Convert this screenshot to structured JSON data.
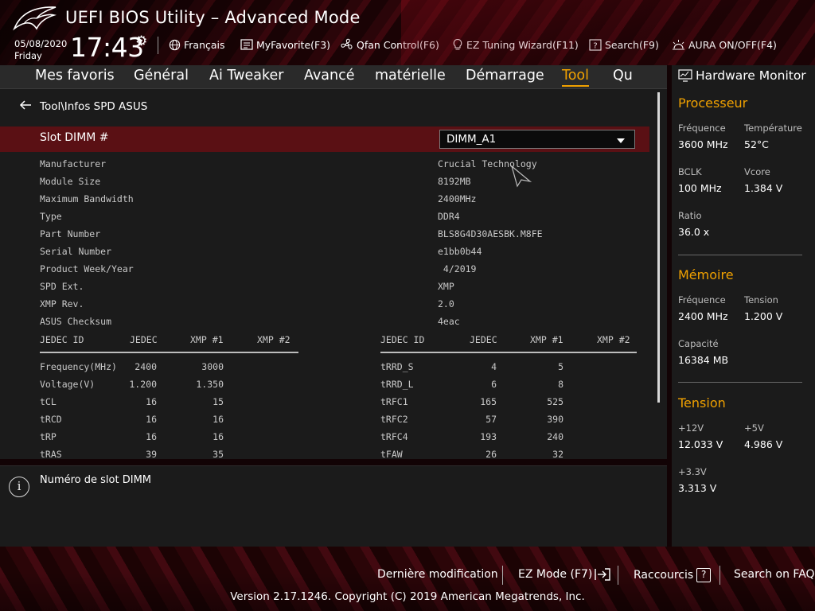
{
  "header": {
    "title": "UEFI BIOS Utility – Advanced Mode",
    "date": "05/08/2020",
    "day": "Friday",
    "time": "17:43",
    "buttons": [
      {
        "label": "Français",
        "icon": "globe-icon"
      },
      {
        "label": "MyFavorite(F3)",
        "icon": "favorite-icon"
      },
      {
        "label": "Qfan Control(F6)",
        "icon": "fan-icon"
      },
      {
        "label": "EZ Tuning Wizard(F11)",
        "icon": "bulb-icon"
      },
      {
        "label": "Search(F9)",
        "icon": "search-help-icon"
      },
      {
        "label": "AURA ON/OFF(F4)",
        "icon": "aura-icon"
      }
    ]
  },
  "tabs": [
    "Mes favoris",
    "Général",
    "Ai Tweaker",
    "Avancé",
    "matérielle",
    "Démarrage",
    "Tool",
    "Qu"
  ],
  "active_tab": "Tool",
  "breadcrumb": "Tool\\Infos SPD ASUS",
  "slot": {
    "label": "Slot DIMM #",
    "value": "DIMM_A1"
  },
  "spd_info": [
    {
      "key": "Manufacturer",
      "value": "Crucial Technology"
    },
    {
      "key": "Module Size",
      "value": "8192MB"
    },
    {
      "key": "Maximum Bandwidth",
      "value": "2400MHz"
    },
    {
      "key": "Type",
      "value": "DDR4"
    },
    {
      "key": "Part Number",
      "value": "BLS8G4D30AESBK.M8FE"
    },
    {
      "key": "Serial Number",
      "value": "e1bb0b44"
    },
    {
      "key": "Product Week/Year",
      "value": " 4/2019"
    },
    {
      "key": "SPD Ext.",
      "value": "XMP"
    },
    {
      "key": "XMP Rev.",
      "value": "2.0"
    },
    {
      "key": "ASUS Checksum",
      "value": "4eac"
    }
  ],
  "timing_table": {
    "headers": [
      "JEDEC ID",
      "JEDEC",
      "XMP #1",
      "XMP #2"
    ],
    "left_rows": [
      [
        "Frequency(MHz)",
        "2400",
        "3000",
        ""
      ],
      [
        "Voltage(V)",
        "1.200",
        "1.350",
        ""
      ],
      [
        "tCL",
        "16",
        "15",
        ""
      ],
      [
        "tRCD",
        "16",
        "16",
        ""
      ],
      [
        "tRP",
        "16",
        "16",
        ""
      ],
      [
        "tRAS",
        "39",
        "35",
        ""
      ]
    ],
    "right_rows": [
      [
        "tRRD_S",
        "4",
        "5",
        ""
      ],
      [
        "tRRD_L",
        "6",
        "8",
        ""
      ],
      [
        "tRFC1",
        "165",
        "525",
        ""
      ],
      [
        "tRFC2",
        "57",
        "390",
        ""
      ],
      [
        "tRFC4",
        "193",
        "240",
        ""
      ],
      [
        "tFAW",
        "26",
        "32",
        ""
      ]
    ]
  },
  "help_text": "Numéro de slot DIMM",
  "hardware_monitor": {
    "title": "Hardware Monitor",
    "sections": [
      {
        "title": "Processeur",
        "items": [
          {
            "label": "Fréquence",
            "value": "3600 MHz"
          },
          {
            "label": "Température",
            "value": "52°C"
          },
          {
            "label": "BCLK",
            "value": "100 MHz"
          },
          {
            "label": "Vcore",
            "value": "1.384 V"
          },
          {
            "label": "Ratio",
            "value": "36.0 x"
          }
        ]
      },
      {
        "title": "Mémoire",
        "items": [
          {
            "label": "Fréquence",
            "value": "2400 MHz"
          },
          {
            "label": "Tension",
            "value": "1.200 V"
          },
          {
            "label": "Capacité",
            "value": "16384 MB"
          }
        ]
      },
      {
        "title": "Tension",
        "items": [
          {
            "label": "+12V",
            "value": "12.033 V"
          },
          {
            "label": "+5V",
            "value": "4.986 V"
          },
          {
            "label": "+3.3V",
            "value": "3.313 V"
          }
        ]
      }
    ]
  },
  "footer": {
    "last_modified": "Dernière modification",
    "ez_mode": "EZ Mode (F7)",
    "shortcuts": "Raccourcis",
    "faq": "Search on FAQ",
    "version": "Version 2.17.1246. Copyright (C) 2019 American Megatrends, Inc."
  },
  "colors": {
    "accent": "#f0a100",
    "selected_row": "#5a1014",
    "panel": "#1b1b1b"
  }
}
